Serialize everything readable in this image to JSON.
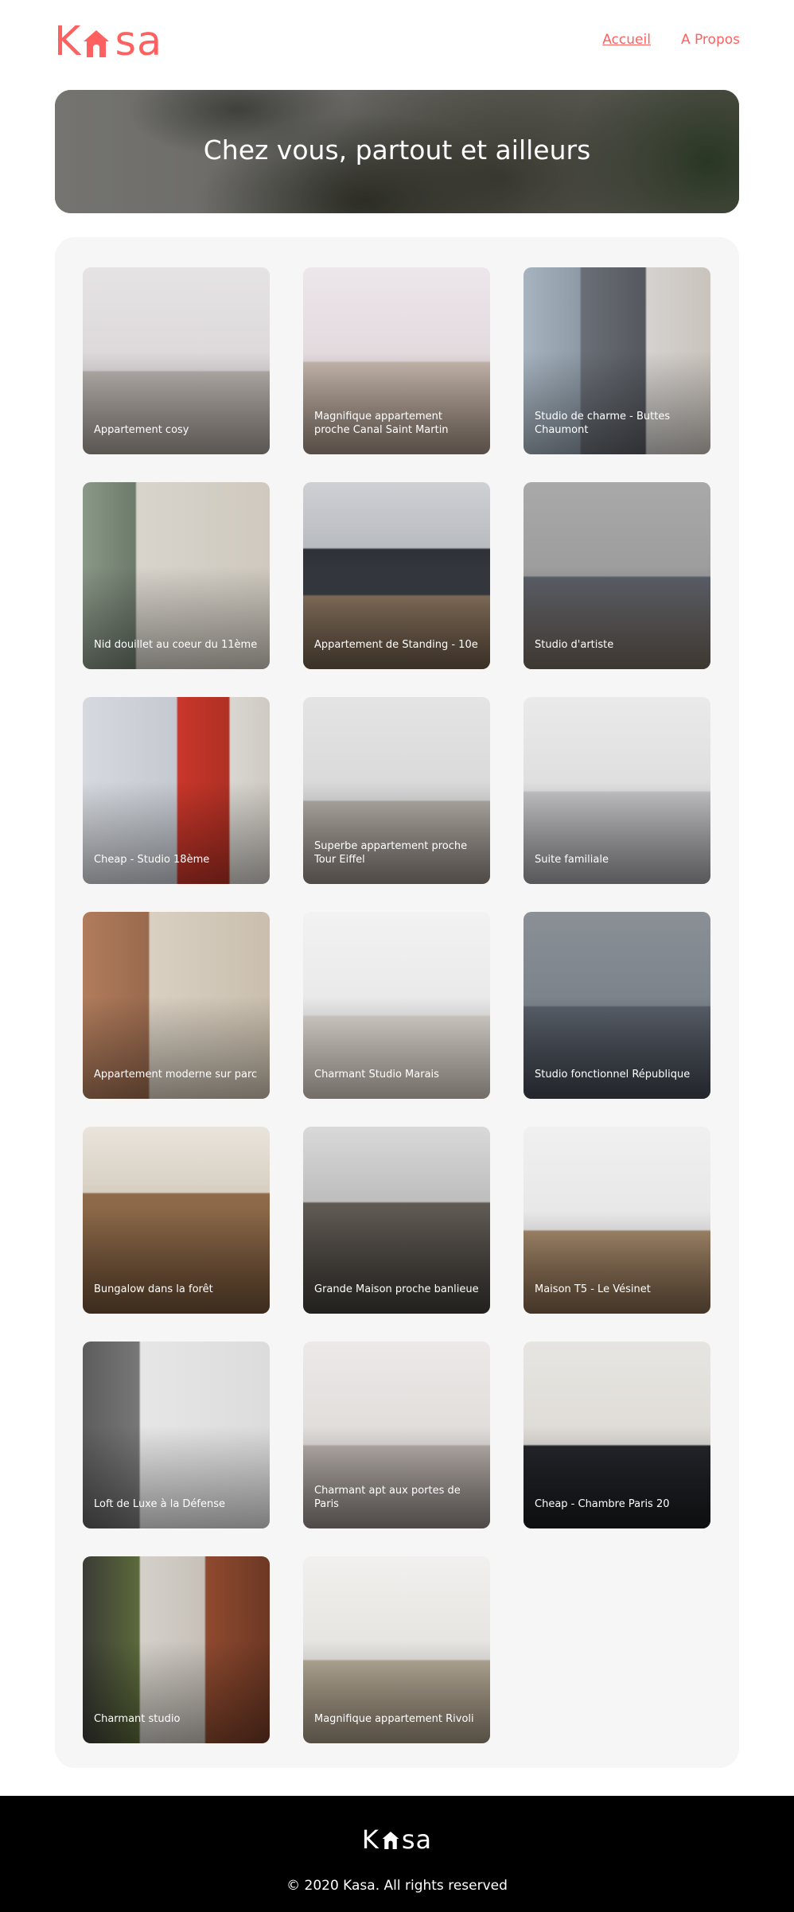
{
  "header": {
    "logo_left": "K",
    "logo_right": "sa",
    "nav": [
      {
        "label": "Accueil",
        "active": true
      },
      {
        "label": "A Propos",
        "active": false
      }
    ]
  },
  "banner": {
    "title": "Chez vous, partout et ailleurs"
  },
  "listings": [
    {
      "title": "Appartement cosy"
    },
    {
      "title": "Magnifique appartement proche Canal Saint Martin"
    },
    {
      "title": "Studio de charme - Buttes Chaumont"
    },
    {
      "title": "Nid douillet au coeur du 11ème"
    },
    {
      "title": "Appartement de Standing - 10e"
    },
    {
      "title": "Studio d'artiste"
    },
    {
      "title": "Cheap - Studio 18ème"
    },
    {
      "title": "Superbe appartement proche Tour Eiffel"
    },
    {
      "title": "Suite familiale"
    },
    {
      "title": "Appartement moderne sur parc"
    },
    {
      "title": "Charmant Studio Marais"
    },
    {
      "title": "Studio fonctionnel République"
    },
    {
      "title": "Bungalow dans la forêt"
    },
    {
      "title": "Grande Maison proche banlieue"
    },
    {
      "title": "Maison T5 - Le Vésinet"
    },
    {
      "title": "Loft de Luxe à la Défense"
    },
    {
      "title": "Charmant apt aux portes de Paris"
    },
    {
      "title": "Cheap - Chambre Paris 20"
    },
    {
      "title": "Charmant studio"
    },
    {
      "title": "Magnifique appartement Rivoli"
    }
  ],
  "footer": {
    "logo_left": "K",
    "logo_right": "sa",
    "copyright": "© 2020 Kasa. All rights reserved"
  },
  "colors": {
    "brand": "#FF6060",
    "gallery_bg": "#F6F6F6",
    "footer_bg": "#000000"
  }
}
